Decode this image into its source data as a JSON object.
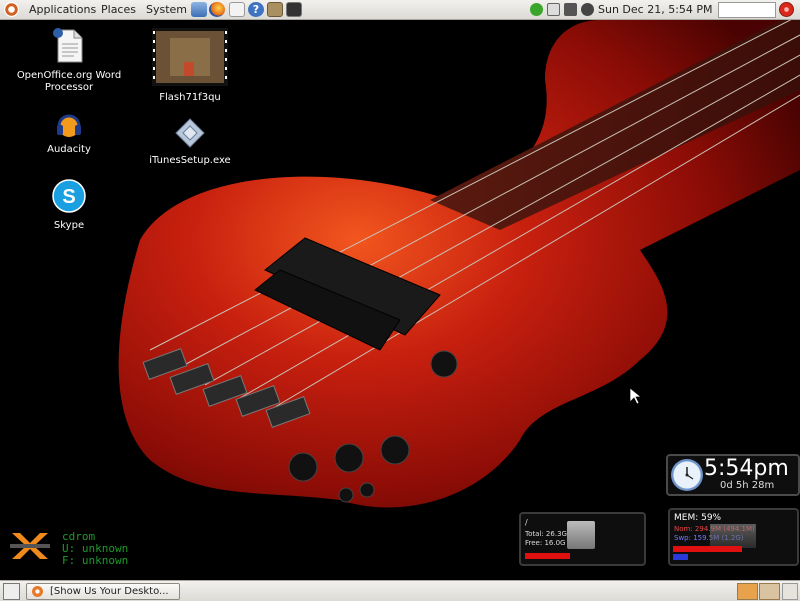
{
  "top_panel": {
    "menus": [
      "Applications",
      "Places",
      "System"
    ],
    "clock": "Sun Dec 21,  5:54 PM"
  },
  "desktop_icons": [
    {
      "label_line1": "OpenOffice.org Word",
      "label_line2": "Processor"
    },
    {
      "label_line1": "Audacity",
      "label_line2": ""
    },
    {
      "label_line1": "Skype",
      "label_line2": ""
    },
    {
      "label_line1": "Flash71f3qu",
      "label_line2": ""
    },
    {
      "label_line1": "iTunesSetup.exe",
      "label_line2": ""
    }
  ],
  "clock_widget": {
    "time": "5:54pm",
    "uptime": "0d 5h 28m"
  },
  "disk_widget": {
    "mount": "/",
    "total": "Total: 26.3G",
    "free": "Free: 16.0G",
    "used_fraction": 0.39
  },
  "mem_widget": {
    "title": "MEM: 59%",
    "nom": "Nom: 294.9M (494.1M)",
    "swp": "Swp: 159.5M (1.2G)",
    "mem_fraction": 0.59,
    "swap_fraction": 0.13
  },
  "cdrom_widget": {
    "line1": "cdrom",
    "line2": "U: unknown",
    "line3": "F: unknown"
  },
  "taskbar": {
    "window_label": "[Show Us Your Deskto..."
  },
  "colors": {
    "panel": "#dcdad5",
    "guitar_red": "#b01a10",
    "monitor_red": "#e01010",
    "cdrom_green": "#1c9a2a"
  }
}
